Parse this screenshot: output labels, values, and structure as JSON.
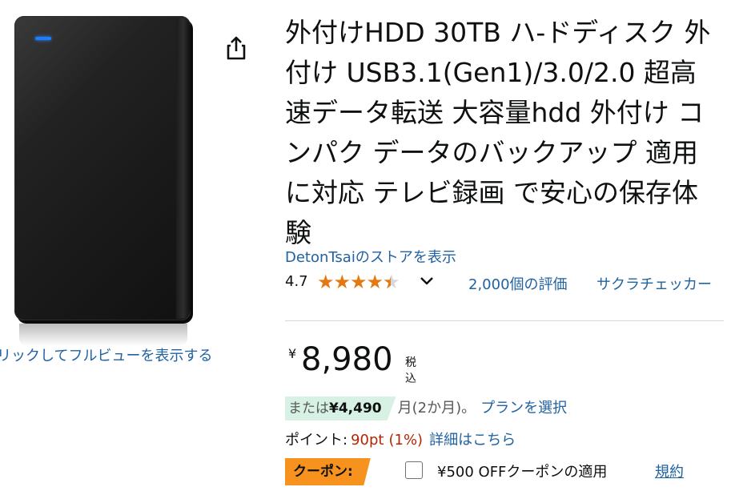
{
  "media": {
    "click_to_view": "リックしてフルビューを表示する"
  },
  "product": {
    "title": "外付けHDD 30TB ハ-ドディスク 外付け USB3.1(Gen1)/3.0/2.0 超高速データ転送 大容量hdd 外付け コンパク データのバックアップ 適用に対応 テレビ録画 で安心の保存体験",
    "store_link": "DetonTsaiのストアを表示"
  },
  "rating": {
    "value": "4.7",
    "stars": 4.5,
    "star_color": "#e47911",
    "review_count": "2,000個の評価",
    "checker": "サクラチェッカー"
  },
  "price": {
    "symbol": "¥",
    "amount": "8,980",
    "tax_note": "税込"
  },
  "installment": {
    "prefix": "または",
    "amount": "¥4,490",
    "suffix": "月(2か月)。",
    "plan_link": "プランを選択"
  },
  "points": {
    "label": "ポイント:",
    "value": "90pt",
    "percent": "(1%)",
    "details_link": "詳細はこちら"
  },
  "coupon": {
    "badge": "クーポン:",
    "text": "¥500 OFFクーポンの適用",
    "terms_link": "規約",
    "badge_color": "#f7921e"
  },
  "icons": {
    "share": "share-icon",
    "chevron": "chevron-down-icon",
    "star": "star-icon"
  },
  "colors": {
    "link": "#2162a1",
    "price_accent": "#b12704",
    "installment_bg": "#d7f2e4"
  }
}
